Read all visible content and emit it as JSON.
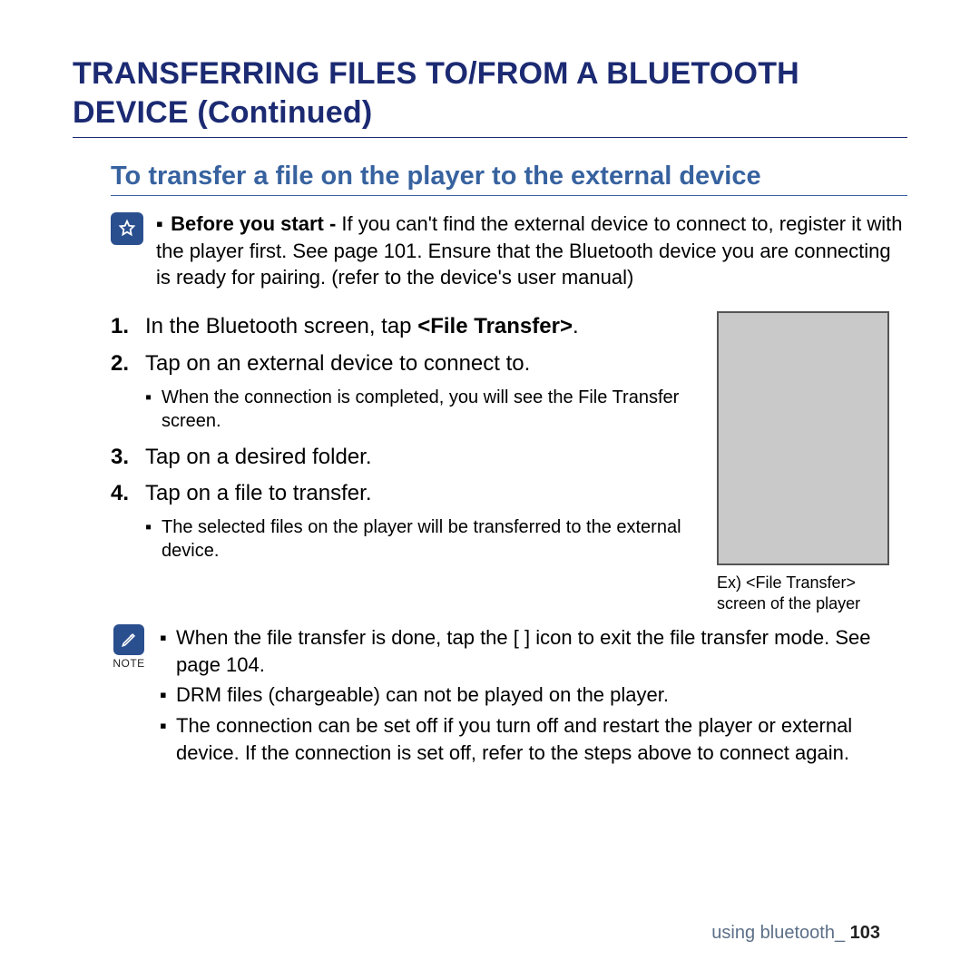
{
  "title": "TRANSFERRING FILES TO/FROM A BLUETOOTH DEVICE (Continued)",
  "subtitle": "To transfer a file on the player to the external device",
  "before": {
    "label": "Before you start - ",
    "text": "If you can't find the external device to connect to, register it with the player first. See page 101. Ensure that the Bluetooth device you are connecting is ready for pairing. (refer to the device's user manual)"
  },
  "steps": {
    "s1_pre": "In the Bluetooth screen, tap ",
    "s1_bold": "<File Transfer>",
    "s1_post": ".",
    "s2": "Tap on an external device to connect to.",
    "s2_sub": "When the connection is completed, you will see the File Transfer screen.",
    "s3": "Tap on a desired folder.",
    "s4": "Tap on a file to transfer.",
    "s4_sub": "The selected files on the player will be transferred to the external device."
  },
  "thumb_caption": "Ex) <File Transfer> screen of the player",
  "note_label": "NOTE",
  "notes": {
    "n1": "When the file transfer is done, tap the [               ] icon to exit the file transfer mode. See page 104.",
    "n2": "DRM files (chargeable) can not be played on the player.",
    "n3": "The connection can be set off if you turn off and restart the player or external device. If the connection is set off, refer to the steps above to connect again."
  },
  "footer": {
    "section": "using bluetooth_ ",
    "page": "103"
  }
}
